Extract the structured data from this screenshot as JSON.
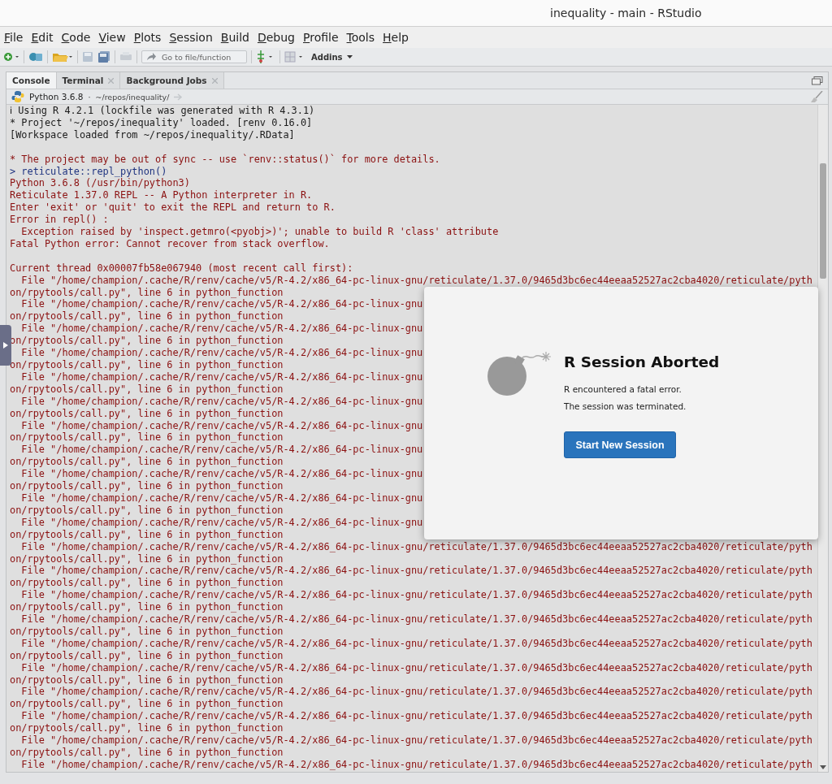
{
  "window": {
    "title": "inequality - main - RStudio"
  },
  "menu": [
    "File",
    "Edit",
    "Code",
    "View",
    "Plots",
    "Session",
    "Build",
    "Debug",
    "Profile",
    "Tools",
    "Help"
  ],
  "toolbar": {
    "goto_placeholder": "Go to file/function",
    "addins": "Addins"
  },
  "tabs": [
    {
      "label": "Console",
      "selected": true,
      "closable": false
    },
    {
      "label": "Terminal",
      "selected": false,
      "closable": true
    },
    {
      "label": "Background Jobs",
      "selected": false,
      "closable": true
    }
  ],
  "console": {
    "interpreter": "Python 3.6.8",
    "separator": "·",
    "path": "~/repos/inequality/",
    "blocks": [
      [
        {
          "kind": "info",
          "text": "ℹ Using R 4.2.1 (lockfile was generated with R 4.3.1)"
        },
        {
          "kind": "info",
          "text": "* Project '~/repos/inequality' loaded. [renv 0.16.0]"
        },
        {
          "kind": "info",
          "text": "[Workspace loaded from ~/repos/inequality/.RData]"
        }
      ],
      [
        {
          "kind": "error",
          "text": "* The project may be out of sync -- use `renv::status()` for more details."
        },
        {
          "kind": "input",
          "text": "> reticulate::repl_python()"
        },
        {
          "kind": "error",
          "text": "Python 3.6.8 (/usr/bin/python3)"
        },
        {
          "kind": "error",
          "text": "Reticulate 1.37.0 REPL -- A Python interpreter in R."
        },
        {
          "kind": "error",
          "text": "Enter 'exit' or 'quit' to exit the REPL and return to R."
        },
        {
          "kind": "error",
          "text": "Error in repl() :"
        },
        {
          "kind": "error",
          "text": "  Exception raised by 'inspect.getmro(<pyobj>)'; unable to build R 'class' attribute"
        },
        {
          "kind": "error",
          "text": "Fatal Python error: Cannot recover from stack overflow."
        }
      ],
      [
        {
          "kind": "error",
          "text": "Current thread 0x00007fb58e067940 (most recent call first):"
        },
        {
          "kind": "error",
          "text": "  File \"/home/champion/.cache/R/renv/cache/v5/R-4.2/x86_64-pc-linux-gnu/reticulate/1.37.0/9465d3bc6ec44eeaa52527ac2cba4020/reticulate/pyth"
        },
        {
          "kind": "error",
          "text": "on/rpytools/call.py\", line 6 in python_function"
        },
        {
          "kind": "error",
          "text": "  File \"/home/champion/.cache/R/renv/cache/v5/R-4.2/x86_64-pc-linux-gnu"
        },
        {
          "kind": "error",
          "text": "on/rpytools/call.py\", line 6 in python_function"
        },
        {
          "kind": "error",
          "text": "  File \"/home/champion/.cache/R/renv/cache/v5/R-4.2/x86_64-pc-linux-gnu"
        },
        {
          "kind": "error",
          "text": "on/rpytools/call.py\", line 6 in python_function"
        },
        {
          "kind": "error",
          "text": "  File \"/home/champion/.cache/R/renv/cache/v5/R-4.2/x86_64-pc-linux-gnu"
        },
        {
          "kind": "error",
          "text": "on/rpytools/call.py\", line 6 in python_function"
        },
        {
          "kind": "error",
          "text": "  File \"/home/champion/.cache/R/renv/cache/v5/R-4.2/x86_64-pc-linux-gnu"
        },
        {
          "kind": "error",
          "text": "on/rpytools/call.py\", line 6 in python_function"
        },
        {
          "kind": "error",
          "text": "  File \"/home/champion/.cache/R/renv/cache/v5/R-4.2/x86_64-pc-linux-gnu"
        },
        {
          "kind": "error",
          "text": "on/rpytools/call.py\", line 6 in python_function"
        },
        {
          "kind": "error",
          "text": "  File \"/home/champion/.cache/R/renv/cache/v5/R-4.2/x86_64-pc-linux-gnu"
        },
        {
          "kind": "error",
          "text": "on/rpytools/call.py\", line 6 in python_function"
        },
        {
          "kind": "error",
          "text": "  File \"/home/champion/.cache/R/renv/cache/v5/R-4.2/x86_64-pc-linux-gnu"
        },
        {
          "kind": "error",
          "text": "on/rpytools/call.py\", line 6 in python_function"
        },
        {
          "kind": "error",
          "text": "  File \"/home/champion/.cache/R/renv/cache/v5/R-4.2/x86_64-pc-linux-gnu"
        },
        {
          "kind": "error",
          "text": "on/rpytools/call.py\", line 6 in python_function"
        },
        {
          "kind": "error",
          "text": "  File \"/home/champion/.cache/R/renv/cache/v5/R-4.2/x86_64-pc-linux-gnu"
        },
        {
          "kind": "error",
          "text": "on/rpytools/call.py\", line 6 in python_function"
        },
        {
          "kind": "error",
          "text": "  File \"/home/champion/.cache/R/renv/cache/v5/R-4.2/x86_64-pc-linux-gnu"
        },
        {
          "kind": "error",
          "text": "on/rpytools/call.py\", line 6 in python_function"
        },
        {
          "kind": "error",
          "text": "  File \"/home/champion/.cache/R/renv/cache/v5/R-4.2/x86_64-pc-linux-gnu/reticulate/1.37.0/9465d3bc6ec44eeaa52527ac2cba4020/reticulate/pyth"
        },
        {
          "kind": "error",
          "text": "on/rpytools/call.py\", line 6 in python_function"
        },
        {
          "kind": "error",
          "text": "  File \"/home/champion/.cache/R/renv/cache/v5/R-4.2/x86_64-pc-linux-gnu/reticulate/1.37.0/9465d3bc6ec44eeaa52527ac2cba4020/reticulate/pyth"
        },
        {
          "kind": "error",
          "text": "on/rpytools/call.py\", line 6 in python_function"
        },
        {
          "kind": "error",
          "text": "  File \"/home/champion/.cache/R/renv/cache/v5/R-4.2/x86_64-pc-linux-gnu/reticulate/1.37.0/9465d3bc6ec44eeaa52527ac2cba4020/reticulate/pyth"
        },
        {
          "kind": "error",
          "text": "on/rpytools/call.py\", line 6 in python_function"
        },
        {
          "kind": "error",
          "text": "  File \"/home/champion/.cache/R/renv/cache/v5/R-4.2/x86_64-pc-linux-gnu/reticulate/1.37.0/9465d3bc6ec44eeaa52527ac2cba4020/reticulate/pyth"
        },
        {
          "kind": "error",
          "text": "on/rpytools/call.py\", line 6 in python_function"
        },
        {
          "kind": "error",
          "text": "  File \"/home/champion/.cache/R/renv/cache/v5/R-4.2/x86_64-pc-linux-gnu/reticulate/1.37.0/9465d3bc6ec44eeaa52527ac2cba4020/reticulate/pyth"
        },
        {
          "kind": "error",
          "text": "on/rpytools/call.py\", line 6 in python_function"
        },
        {
          "kind": "error",
          "text": "  File \"/home/champion/.cache/R/renv/cache/v5/R-4.2/x86_64-pc-linux-gnu/reticulate/1.37.0/9465d3bc6ec44eeaa52527ac2cba4020/reticulate/pyth"
        },
        {
          "kind": "error",
          "text": "on/rpytools/call.py\", line 6 in python_function"
        },
        {
          "kind": "error",
          "text": "  File \"/home/champion/.cache/R/renv/cache/v5/R-4.2/x86_64-pc-linux-gnu/reticulate/1.37.0/9465d3bc6ec44eeaa52527ac2cba4020/reticulate/pyth"
        },
        {
          "kind": "error",
          "text": "on/rpytools/call.py\", line 6 in python_function"
        },
        {
          "kind": "error",
          "text": "  File \"/home/champion/.cache/R/renv/cache/v5/R-4.2/x86_64-pc-linux-gnu/reticulate/1.37.0/9465d3bc6ec44eeaa52527ac2cba4020/reticulate/pyth"
        },
        {
          "kind": "error",
          "text": "on/rpytools/call.py\", line 6 in python_function"
        },
        {
          "kind": "error",
          "text": "  File \"/home/champion/.cache/R/renv/cache/v5/R-4.2/x86_64-pc-linux-gnu/reticulate/1.37.0/9465d3bc6ec44eeaa52527ac2cba4020/reticulate/pyth"
        },
        {
          "kind": "error",
          "text": "on/rpytools/call.py\", line 6 in python_function"
        },
        {
          "kind": "error",
          "text": "  File \"/home/champion/.cache/R/renv/cache/v5/R-4.2/x86_64-pc-linux-gnu/reticulate/1.37.0/9465d3bc6ec44eeaa52527ac2cba4020/reticulate/pyth"
        }
      ]
    ]
  },
  "dialog": {
    "title": "R Session Aborted",
    "messages": [
      "R encountered a fatal error.",
      "The session was terminated."
    ],
    "button": "Start New Session"
  }
}
